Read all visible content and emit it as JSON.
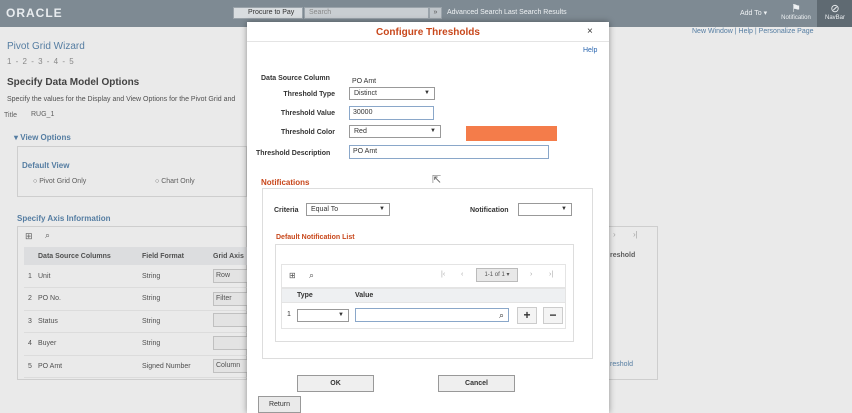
{
  "topbar": {
    "logo": "ORACLE",
    "search_scope": "Procure to Pay",
    "search_placeholder": "Search",
    "advanced_search": "Advanced Search",
    "last_search": "Last Search Results",
    "add_to": "Add To",
    "notification": "Notification",
    "navbar": "NavBar"
  },
  "background": {
    "top_links": "New Window  |  Help  |  Personalize Page",
    "wizard_title": "Pivot Grid Wizard",
    "steps": "1 - 2 - 3 - 4 - 5",
    "heading": "Specify Data Model Options",
    "description": "Specify the values for the Display and View Options for the Pivot Grid and",
    "title_label": "Title",
    "title_value": "RUG_1",
    "view_options": "View Options",
    "default_view": "Default View",
    "radio_pivot": "Pivot Grid Only",
    "radio_chart": "Chart Only",
    "axis_info": "Specify Axis Information",
    "threshold_header": "reshold",
    "threshold_link": "reshold",
    "columns": [
      "Data Source Columns",
      "Field Format",
      "Grid Axis"
    ],
    "rows": [
      {
        "num": "1",
        "col": "Unit",
        "fmt": "String",
        "axis": "Row"
      },
      {
        "num": "2",
        "col": "PO No.",
        "fmt": "String",
        "axis": "Filter"
      },
      {
        "num": "3",
        "col": "Status",
        "fmt": "String",
        "axis": ""
      },
      {
        "num": "4",
        "col": "Buyer",
        "fmt": "String",
        "axis": ""
      },
      {
        "num": "5",
        "col": "PO Amt",
        "fmt": "Signed Number",
        "axis": "Column"
      }
    ],
    "return_button": "Return"
  },
  "modal": {
    "title": "Configure Thresholds",
    "close": "×",
    "help": "Help",
    "data_source_label": "Data Source Column",
    "data_source_value": "PO Amt",
    "threshold_type_label": "Threshold Type",
    "threshold_type_value": "Distinct",
    "threshold_value_label": "Threshold Value",
    "threshold_value": "30000",
    "threshold_color_label": "Threshold Color",
    "threshold_color_value": "Red",
    "threshold_color_swatch": "#f47c4a",
    "threshold_desc_label": "Threshold Description",
    "threshold_desc_value": "PO Amt",
    "notifications_heading": "Notifications",
    "criteria_label": "Criteria",
    "criteria_value": "Equal To",
    "notification_label": "Notification",
    "notification_value": "",
    "default_list_heading": "Default Notification List",
    "pager_text": "1-1 of 1",
    "grid_columns": {
      "type": "Type",
      "value": "Value"
    },
    "grid_row_num": "1",
    "ok_button": "OK",
    "cancel_button": "Cancel"
  }
}
